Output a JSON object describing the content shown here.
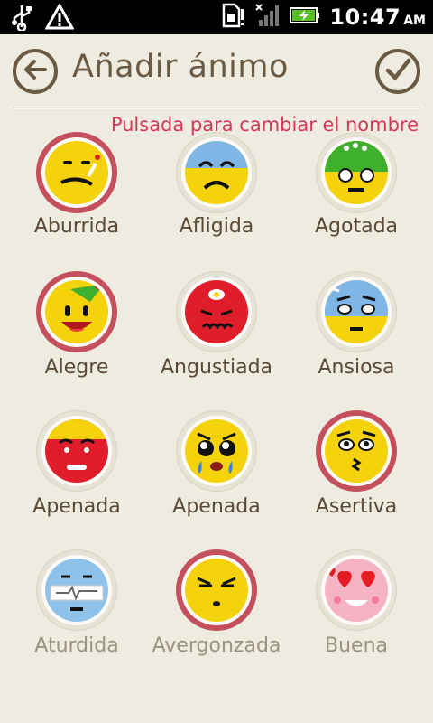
{
  "status_bar": {
    "time": "10:47",
    "ampm": "AM"
  },
  "header": {
    "title": "Añadir ánimo"
  },
  "hint": "Pulsada para cambiar el nombre",
  "moods": [
    {
      "label": "Aburrida",
      "selected": true,
      "color": "#f4d20c"
    },
    {
      "label": "Afligida",
      "selected": false,
      "color": "#f4d20c"
    },
    {
      "label": "Agotada",
      "selected": false,
      "color": "#f4d20c"
    },
    {
      "label": "Alegre",
      "selected": true,
      "color": "#f4d20c"
    },
    {
      "label": "Angustiada",
      "selected": false,
      "color": "#e01d2b"
    },
    {
      "label": "Ansiosa",
      "selected": false,
      "color": "#f4d20c"
    },
    {
      "label": "Apenada",
      "selected": false,
      "color": "#e01d2b"
    },
    {
      "label": "Apenada",
      "selected": false,
      "color": "#f4d20c"
    },
    {
      "label": "Asertiva",
      "selected": true,
      "color": "#f4d20c"
    },
    {
      "label": "Aturdida",
      "selected": false,
      "color": "#8fc2e8"
    },
    {
      "label": "Avergonzada",
      "selected": true,
      "color": "#f4d20c"
    },
    {
      "label": "Buena",
      "selected": false,
      "color": "#f7b3c6"
    }
  ]
}
